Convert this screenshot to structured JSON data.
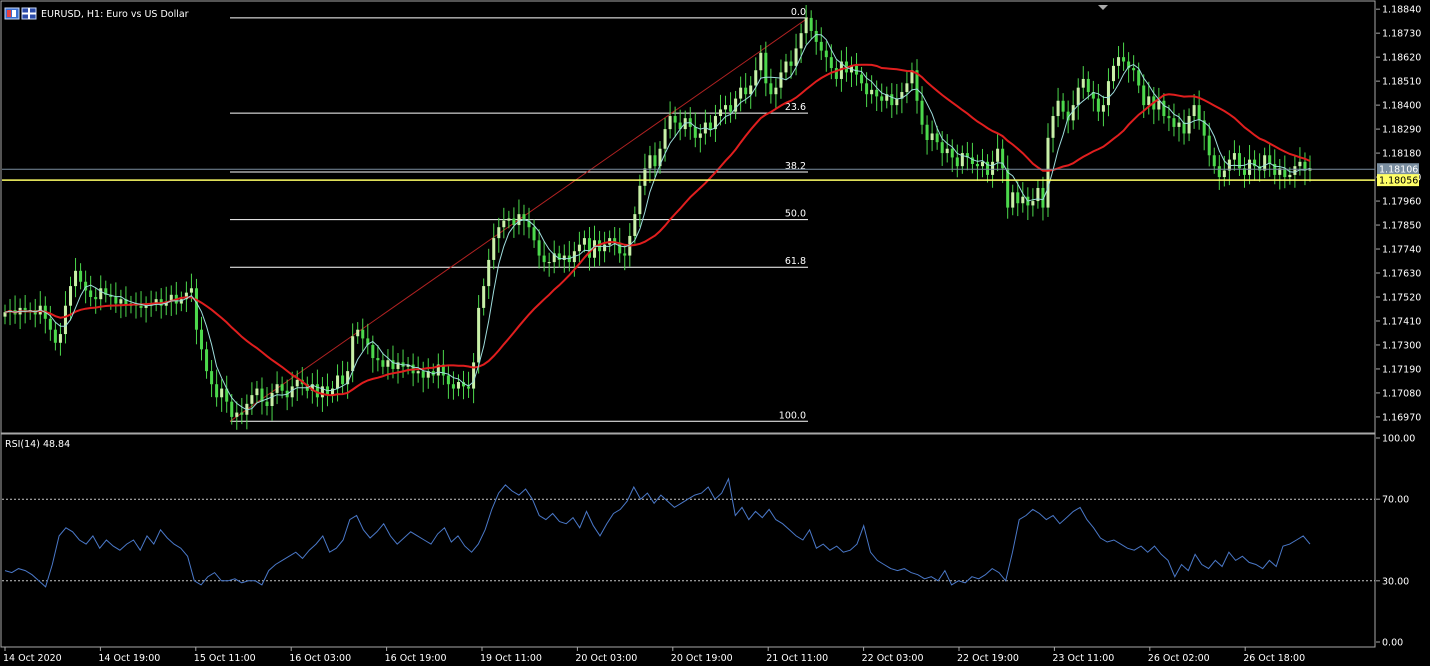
{
  "window": {
    "symbol_title": "EURUSD, H1:  Euro vs US Dollar",
    "rsi_title": "RSI(14) 48.84"
  },
  "colors": {
    "background": "#000000",
    "grid_frame": "#a8a8a8",
    "candle_bull": "#c8f0a8",
    "candle_bear": "#4cd84c",
    "ma_fast": "#9edcdc",
    "ma_slow": "#e01e1e",
    "fib_line": "#ffffff",
    "fib_trend": "#b22222",
    "current_price": "#7a8ea0",
    "level_highlight": "#ffff66",
    "rsi_line": "#4a78c8"
  },
  "chart_data": [
    {
      "type": "candlestick",
      "name": "EURUSD H1",
      "ylim": [
        1.1691,
        1.1885
      ],
      "y_ticks": [
        "1.18840",
        "1.18730",
        "1.18620",
        "1.18510",
        "1.18400",
        "1.18290",
        "1.18180",
        "1.18070",
        "1.17960",
        "1.17850",
        "1.17740",
        "1.17630",
        "1.17520",
        "1.17410",
        "1.17300",
        "1.17190",
        "1.17080",
        "1.16970"
      ],
      "x_ticks": [
        "14 Oct 2020",
        "14 Oct 19:00",
        "15 Oct 11:00",
        "16 Oct 03:00",
        "16 Oct 19:00",
        "19 Oct 11:00",
        "20 Oct 03:00",
        "20 Oct 19:00",
        "21 Oct 11:00",
        "22 Oct 03:00",
        "22 Oct 19:00",
        "23 Oct 11:00",
        "26 Oct 02:00",
        "26 Oct 18:00"
      ],
      "price_labels": [
        {
          "text": "1.18106",
          "value": 1.18106,
          "kind": "current"
        },
        {
          "text": "1.18056",
          "value": 1.18056,
          "kind": "highlight"
        }
      ],
      "fibonacci": {
        "high": 1.188,
        "low": 1.1695,
        "levels": [
          {
            "label": "0.0",
            "ratio": 0.0
          },
          {
            "label": "23.6",
            "ratio": 0.236
          },
          {
            "label": "38.2",
            "ratio": 0.382
          },
          {
            "label": "50.0",
            "ratio": 0.5
          },
          {
            "label": "61.8",
            "ratio": 0.618
          },
          {
            "label": "100.0",
            "ratio": 1.0
          }
        ],
        "start_bar": 45,
        "end_bar": 160
      },
      "closes": [
        1.1745,
        1.1746,
        1.1744,
        1.1747,
        1.1745,
        1.1746,
        1.1744,
        1.1748,
        1.1742,
        1.1737,
        1.1731,
        1.1735,
        1.1748,
        1.1757,
        1.1764,
        1.1759,
        1.1755,
        1.1752,
        1.1751,
        1.1756,
        1.1753,
        1.1752,
        1.1749,
        1.1751,
        1.1748,
        1.1749,
        1.1748,
        1.1747,
        1.1748,
        1.1749,
        1.1751,
        1.1748,
        1.175,
        1.1753,
        1.1749,
        1.1751,
        1.1754,
        1.1756,
        1.1737,
        1.1728,
        1.1718,
        1.1712,
        1.1706,
        1.171,
        1.1704,
        1.1697,
        1.1699,
        1.1698,
        1.1703,
        1.1707,
        1.171,
        1.1704,
        1.1702,
        1.1708,
        1.1712,
        1.1709,
        1.1706,
        1.1711,
        1.1714,
        1.1712,
        1.1709,
        1.1712,
        1.1706,
        1.1711,
        1.1707,
        1.171,
        1.1716,
        1.1712,
        1.1718,
        1.1734,
        1.1737,
        1.1733,
        1.173,
        1.1724,
        1.1723,
        1.172,
        1.1723,
        1.1719,
        1.1722,
        1.172,
        1.1721,
        1.1717,
        1.1718,
        1.1715,
        1.1718,
        1.1716,
        1.1721,
        1.1716,
        1.1712,
        1.171,
        1.1713,
        1.1711,
        1.171,
        1.1722,
        1.1747,
        1.1757,
        1.1769,
        1.1779,
        1.1784,
        1.1787,
        1.1788,
        1.1785,
        1.179,
        1.1787,
        1.1784,
        1.1778,
        1.1771,
        1.1768,
        1.1768,
        1.1772,
        1.1769,
        1.1771,
        1.1768,
        1.1773,
        1.1776,
        1.1779,
        1.177,
        1.1778,
        1.1773,
        1.1776,
        1.1779,
        1.1777,
        1.1772,
        1.1771,
        1.178,
        1.179,
        1.1803,
        1.1811,
        1.1817,
        1.1812,
        1.182,
        1.1829,
        1.1835,
        1.1832,
        1.1829,
        1.1834,
        1.183,
        1.1825,
        1.1827,
        1.1832,
        1.1829,
        1.1835,
        1.1838,
        1.184,
        1.1837,
        1.1843,
        1.1848,
        1.1845,
        1.1849,
        1.1856,
        1.1864,
        1.185,
        1.1845,
        1.1848,
        1.1855,
        1.186,
        1.1858,
        1.1866,
        1.1873,
        1.188,
        1.1874,
        1.1869,
        1.1865,
        1.1862,
        1.1857,
        1.1852,
        1.186,
        1.1855,
        1.1858,
        1.1854,
        1.185,
        1.1845,
        1.1847,
        1.1844,
        1.1842,
        1.1845,
        1.184,
        1.1843,
        1.1846,
        1.185,
        1.1856,
        1.1842,
        1.1831,
        1.1824,
        1.1827,
        1.1823,
        1.1818,
        1.182,
        1.1816,
        1.1812,
        1.1818,
        1.1816,
        1.1813,
        1.1812,
        1.1814,
        1.1808,
        1.1814,
        1.182,
        1.1811,
        1.1793,
        1.18,
        1.1795,
        1.1798,
        1.1794,
        1.1796,
        1.1802,
        1.1793,
        1.1825,
        1.1835,
        1.1842,
        1.1837,
        1.1833,
        1.184,
        1.1848,
        1.1852,
        1.1846,
        1.1843,
        1.1837,
        1.184,
        1.1851,
        1.1858,
        1.1862,
        1.186,
        1.1857,
        1.1856,
        1.1849,
        1.184,
        1.1844,
        1.1838,
        1.1842,
        1.1835,
        1.1834,
        1.183,
        1.1832,
        1.1827,
        1.1835,
        1.184,
        1.1833,
        1.1826,
        1.1817,
        1.1812,
        1.1807,
        1.181,
        1.1815,
        1.1818,
        1.1811,
        1.1808,
        1.1815,
        1.1812,
        1.181,
        1.1817,
        1.1813,
        1.1808,
        1.1811,
        1.1807,
        1.1808,
        1.1812,
        1.1814,
        1.181,
        1.1811
      ]
    },
    {
      "type": "line",
      "name": "RSI(14)",
      "ylim": [
        0,
        100
      ],
      "y_ticks": [
        "100.00",
        "70.00",
        "30.00",
        "0.00"
      ],
      "levels": [
        70,
        30
      ],
      "values": [
        35,
        34,
        36,
        35,
        33,
        30,
        27,
        38,
        52,
        56,
        54,
        50,
        48,
        52,
        46,
        50,
        47,
        45,
        48,
        50,
        45,
        52,
        48,
        55,
        51,
        48,
        46,
        42,
        30,
        28,
        32,
        34,
        30,
        30,
        31,
        29,
        30,
        30,
        28,
        35,
        38,
        40,
        42,
        44,
        41,
        45,
        48,
        52,
        44,
        46,
        50,
        60,
        62,
        55,
        51,
        54,
        58,
        52,
        48,
        51,
        54,
        52,
        50,
        48,
        53,
        56,
        49,
        52,
        47,
        44,
        48,
        55,
        65,
        73,
        77,
        74,
        72,
        75,
        70,
        62,
        60,
        63,
        59,
        58,
        61,
        56,
        64,
        57,
        52,
        58,
        63,
        65,
        69,
        76,
        70,
        73,
        68,
        72,
        69,
        66,
        68,
        70,
        72,
        73,
        76,
        70,
        73,
        80,
        62,
        66,
        60,
        64,
        61,
        65,
        60,
        58,
        55,
        52,
        50,
        55,
        46,
        48,
        45,
        47,
        44,
        45,
        48,
        57,
        44,
        40,
        38,
        36,
        35,
        36,
        34,
        33,
        31,
        32,
        30,
        35,
        28,
        30,
        29,
        32,
        31,
        33,
        36,
        34,
        30,
        44,
        60,
        62,
        65,
        63,
        60,
        62,
        58,
        61,
        64,
        66,
        60,
        56,
        51,
        49,
        50,
        48,
        46,
        45,
        47,
        44,
        47,
        43,
        40,
        32,
        38,
        35,
        43,
        38,
        36,
        40,
        37,
        44,
        40,
        42,
        39,
        38,
        36,
        40,
        37,
        47,
        48,
        50,
        52,
        48
      ]
    }
  ]
}
